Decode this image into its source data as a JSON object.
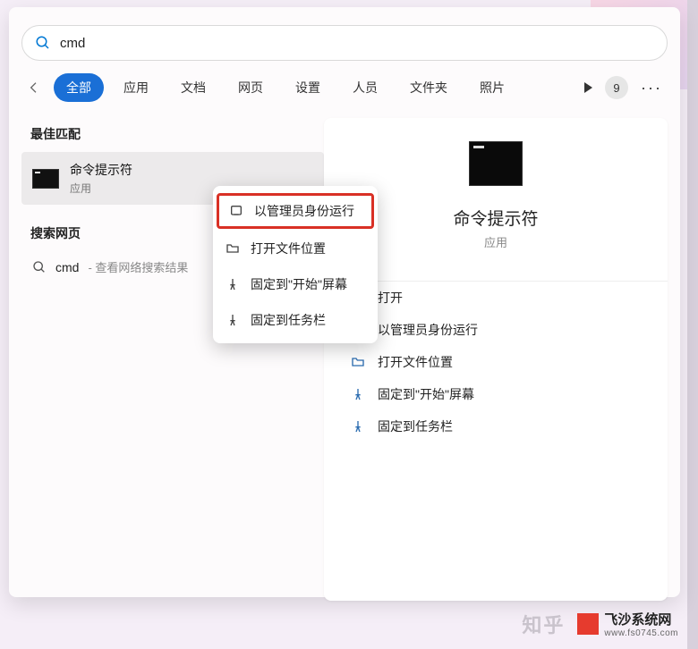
{
  "search": {
    "query": "cmd"
  },
  "filters": {
    "items": [
      "全部",
      "应用",
      "文档",
      "网页",
      "设置",
      "人员",
      "文件夹",
      "照片"
    ],
    "active_index": 0,
    "count_badge": "9"
  },
  "left": {
    "best_match_label": "最佳匹配",
    "result": {
      "title": "命令提示符",
      "subtitle": "应用"
    },
    "web_label": "搜索网页",
    "web_row": {
      "query": "cmd",
      "hint": " - 查看网络搜索结果"
    }
  },
  "context_menu": {
    "items": [
      {
        "icon": "admin",
        "label": "以管理员身份运行",
        "highlight": true
      },
      {
        "icon": "folder",
        "label": "打开文件位置"
      },
      {
        "icon": "pin",
        "label": "固定到\"开始\"屏幕"
      },
      {
        "icon": "pin",
        "label": "固定到任务栏"
      }
    ]
  },
  "preview": {
    "title": "命令提示符",
    "subtitle": "应用",
    "actions": [
      {
        "icon": "",
        "label": "打开"
      },
      {
        "icon": "admin",
        "label": "以管理员身份运行"
      },
      {
        "icon": "folder",
        "label": "打开文件位置"
      },
      {
        "icon": "pin",
        "label": "固定到\"开始\"屏幕"
      },
      {
        "icon": "pin",
        "label": "固定到任务栏"
      }
    ]
  },
  "watermark": {
    "zhihu": "知乎",
    "site_name": "飞沙系统网",
    "site_url": "www.fs0745.com"
  }
}
